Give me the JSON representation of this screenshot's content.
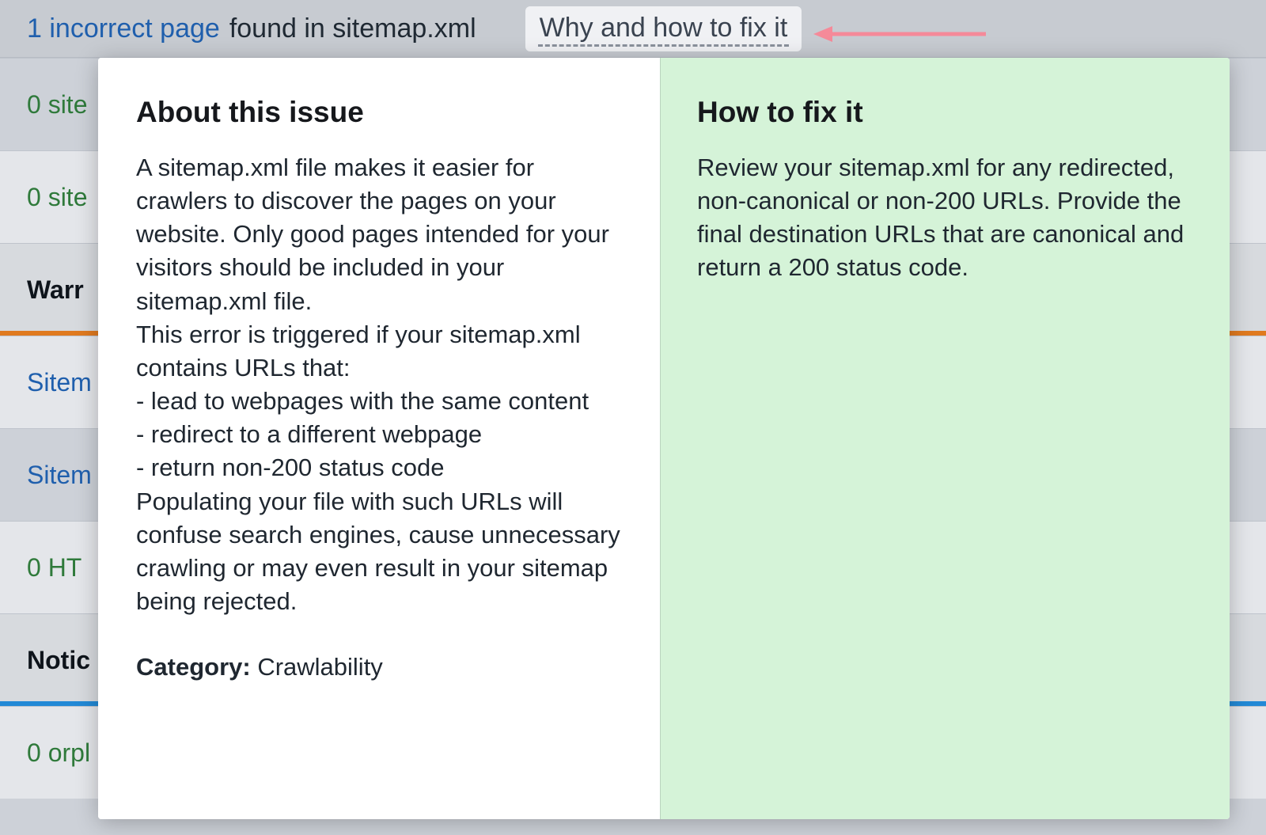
{
  "header": {
    "link_text": "1 incorrect page",
    "suffix_text": "found in sitemap.xml",
    "why_fix_label": "Why and how to fix it"
  },
  "bg_rows": [
    {
      "type": "item",
      "text": "0 site"
    },
    {
      "type": "item",
      "text": "0 site"
    },
    {
      "type": "section",
      "label": "Warr",
      "underline": "orange"
    },
    {
      "type": "item",
      "text": "Sitem",
      "is_link": true
    },
    {
      "type": "item",
      "text": "Sitem",
      "is_link": true
    },
    {
      "type": "item",
      "text": "0 HT"
    },
    {
      "type": "section",
      "label": "Notic",
      "underline": "blue"
    },
    {
      "type": "item",
      "text": "0 orpl"
    }
  ],
  "panel": {
    "about_title": "About this issue",
    "about_body": "A sitemap.xml file makes it easier for crawlers to discover the pages on your website. Only good pages intended for your visitors should be included in your sitemap.xml file.\nThis error is triggered if your sitemap.xml contains URLs that:\n- lead to webpages with the same content\n- redirect to a different webpage\n- return non-200 status code\nPopulating your file with such URLs will confuse search engines, cause unnecessary crawling or may even result in your sitemap being rejected.",
    "category_label": "Category:",
    "category_value": "Crawlability",
    "fix_title": "How to fix it",
    "fix_body": "Review your sitemap.xml for any redirected, non-canonical or non-200 URLs. Provide the final destination URLs that are canonical and return a 200 status code."
  },
  "colors": {
    "link_blue": "#1f5fad",
    "count_green": "#2f7a3b"
  }
}
